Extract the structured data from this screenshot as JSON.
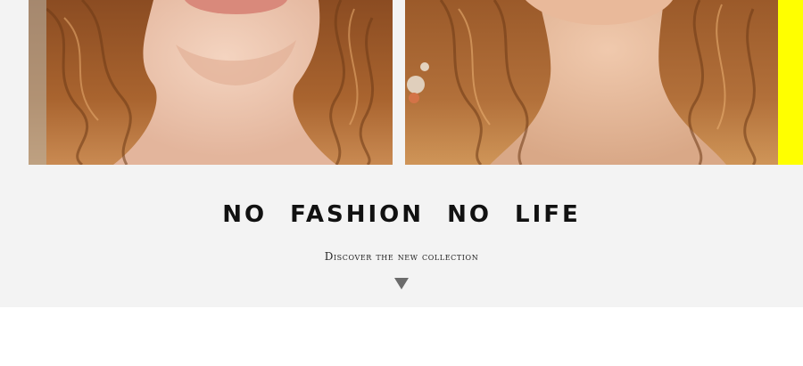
{
  "hero": {
    "headline": "NO FASHION NO LIFE",
    "subline": "Discover the new collection",
    "scroll_icon": "triangle-down-icon"
  },
  "colors": {
    "banner_background": "#f3f3f3",
    "accent_yellow": "#ffff00",
    "headline_text": "#111111",
    "arrow": "#6b6b6b"
  }
}
